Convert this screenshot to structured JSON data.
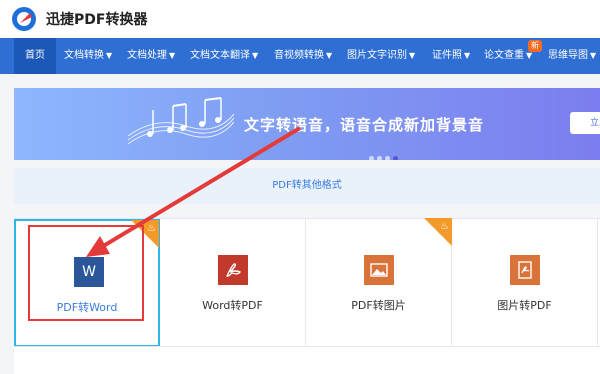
{
  "app": {
    "title": "迅捷PDF转换器"
  },
  "nav": {
    "items": [
      {
        "label": "首页"
      },
      {
        "label": "文档转换"
      },
      {
        "label": "文档处理"
      },
      {
        "label": "文档文本翻译"
      },
      {
        "label": "音视频转换"
      },
      {
        "label": "图片文字识别"
      },
      {
        "label": "证件照"
      },
      {
        "label": "论文查重"
      },
      {
        "label": "思维导图"
      }
    ],
    "new_badge": "新"
  },
  "banner": {
    "text": "文字转语音，语音合成新加背景音",
    "button_label": "立即"
  },
  "format_bar": {
    "label": "PDF转其他格式"
  },
  "cards": [
    {
      "icon_text": "W",
      "label": "PDF转Word"
    },
    {
      "icon_text": "",
      "label": "Word转PDF"
    },
    {
      "icon_text": "",
      "label": "PDF转图片"
    },
    {
      "icon_text": "",
      "label": "图片转PDF"
    }
  ],
  "colors": {
    "nav": "#2f6fd4",
    "accent_blue": "#3b7be0",
    "highlight_red": "#e53a3a",
    "hot_orange": "#f39a2b",
    "word_blue": "#2b579a",
    "pdf_red": "#c0392b",
    "image_orange": "#d9733a"
  }
}
